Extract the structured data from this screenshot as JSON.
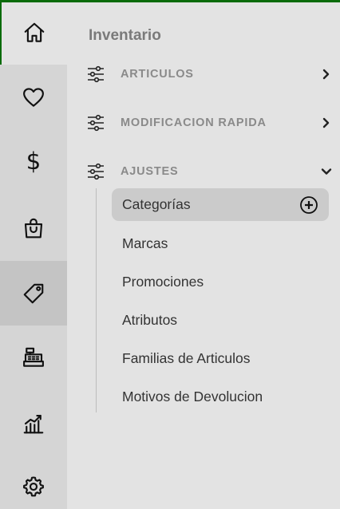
{
  "colors": {
    "accent": "#0a6b0a",
    "rail_bg": "#d5d5d5",
    "panel_bg": "#e3e3e3",
    "active_bg": "#cbcbcb"
  },
  "rail": {
    "items": [
      {
        "icon": "home-icon"
      },
      {
        "icon": "heart-icon"
      },
      {
        "icon": "dollar-icon",
        "glyph": "$"
      },
      {
        "icon": "shopping-bag-icon"
      },
      {
        "icon": "tag-icon",
        "active": true
      },
      {
        "icon": "cash-register-icon"
      },
      {
        "icon": "chart-growth-icon"
      },
      {
        "icon": "gear-icon"
      }
    ]
  },
  "panel": {
    "title": "Inventario",
    "sections": [
      {
        "label": "ARTICULOS",
        "icon": "sliders-icon",
        "expanded": false
      },
      {
        "label": "MODIFICACION RAPIDA",
        "icon": "sliders-icon",
        "expanded": false
      },
      {
        "label": "AJUSTES",
        "icon": "sliders-icon",
        "expanded": true
      }
    ],
    "subitems": [
      {
        "label": "Categorías",
        "active": true
      },
      {
        "label": "Marcas"
      },
      {
        "label": "Promociones"
      },
      {
        "label": "Atributos"
      },
      {
        "label": "Familias de Articulos"
      },
      {
        "label": "Motivos de Devolucion"
      }
    ]
  }
}
